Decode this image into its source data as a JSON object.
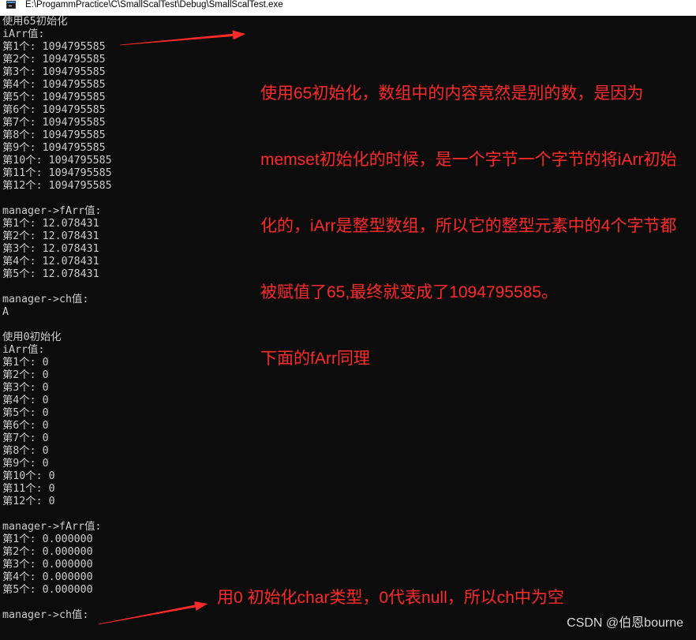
{
  "window": {
    "title": "E:\\ProgammPractice\\C\\SmallScalTest\\Debug\\SmallScalTest.exe",
    "icon": "console-app-icon"
  },
  "console": {
    "lines": [
      "使用65初始化",
      "iArr值:",
      "第1个: 1094795585",
      "第2个: 1094795585",
      "第3个: 1094795585",
      "第4个: 1094795585",
      "第5个: 1094795585",
      "第6个: 1094795585",
      "第7个: 1094795585",
      "第8个: 1094795585",
      "第9个: 1094795585",
      "第10个: 1094795585",
      "第11个: 1094795585",
      "第12个: 1094795585",
      "",
      "manager->fArr值:",
      "第1个: 12.078431",
      "第2个: 12.078431",
      "第3个: 12.078431",
      "第4个: 12.078431",
      "第5个: 12.078431",
      "",
      "manager->ch值:",
      "A",
      "",
      "使用0初始化",
      "iArr值:",
      "第1个: 0",
      "第2个: 0",
      "第3个: 0",
      "第4个: 0",
      "第5个: 0",
      "第6个: 0",
      "第7个: 0",
      "第8个: 0",
      "第9个: 0",
      "第10个: 0",
      "第11个: 0",
      "第12个: 0",
      "",
      "manager->fArr值:",
      "第1个: 0.000000",
      "第2个: 0.000000",
      "第3个: 0.000000",
      "第4个: 0.000000",
      "第5个: 0.000000",
      "",
      "manager->ch值:"
    ]
  },
  "annotations": {
    "top_note": [
      "使用65初始化，数组中的内容竟然是别的数，是因为",
      "memset初始化的时候，是一个字节一个字节的将iArr初始",
      "化的，iArr是整型数组，所以它的整型元素中的4个字节都",
      "被赋值了65,最终就变成了1094795585。",
      "下面的fArr同理"
    ],
    "bottom_note": "用0 初始化char类型，0代表null，所以ch中为空"
  },
  "watermark": "CSDN @伯恩bourne",
  "colors": {
    "console_bg": "#0c0c0c",
    "console_text": "#cccccc",
    "annotation": "#ff2a2a",
    "titlebar_bg": "#ffffff",
    "titlebar_text": "#000000",
    "watermark": "#d9d9d9"
  }
}
